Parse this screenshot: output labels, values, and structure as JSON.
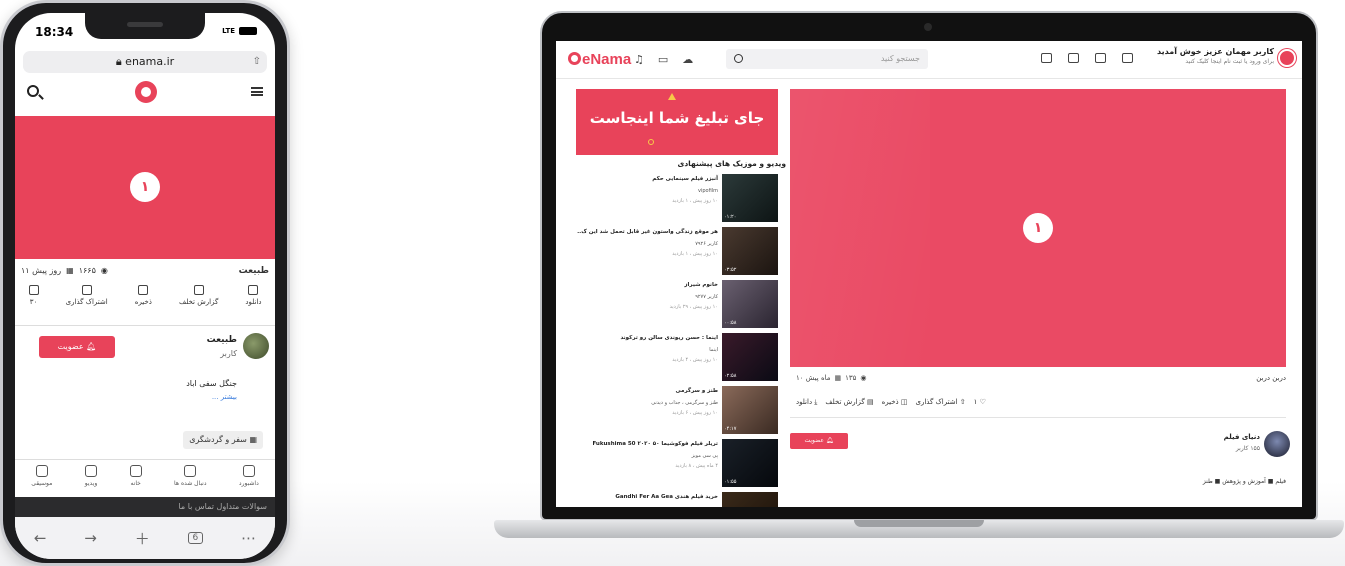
{
  "colors": {
    "brand": "#e8435a",
    "phone_frame": "#1c1c1e",
    "laptop_frame": "#111111"
  },
  "phone": {
    "status": {
      "time": "18:34",
      "network": "LTE"
    },
    "url": "enama.ir",
    "video_number": "۱",
    "meta": {
      "title": "طبیعت",
      "views": "۱۶۶۵",
      "date": "۱۱ روز پیش"
    },
    "actions": [
      {
        "label": "۳۰",
        "icon": "heart-icon"
      },
      {
        "label": "اشتراک گذاری",
        "icon": "share-icon"
      },
      {
        "label": "ذخیره",
        "icon": "bookmark-icon"
      },
      {
        "label": "گزارش تخلف",
        "icon": "report-icon"
      },
      {
        "label": "دانلود",
        "icon": "download-icon"
      }
    ],
    "channel": {
      "name": "طبیعت",
      "subtitle": "کاربر",
      "subscribe_label": "عضویت"
    },
    "description": "جنگل سفی اباد",
    "more_label": "بیشتر ...",
    "tag": "سفر و گردشگری",
    "bottom_nav": [
      {
        "label": "موسیقی",
        "icon": "music-icon"
      },
      {
        "label": "ویدیو",
        "icon": "video-icon"
      },
      {
        "label": "خانه",
        "icon": "home-icon"
      },
      {
        "label": "دنبال شده ها",
        "icon": "bell-icon"
      },
      {
        "label": "داشبورد",
        "icon": "user-icon"
      }
    ],
    "footer": "سوالات متداول   تماس با ما",
    "browser": {
      "tabs_count": "6"
    }
  },
  "laptop": {
    "logo": "eNama",
    "search_placeholder": "جستجو کنید",
    "user": {
      "greeting": "کاربر مهمان عزیز خوش آمدید",
      "hint": "برای ورود یا ثبت نام اینجا کلیک کنید"
    },
    "video_number": "۱",
    "video": {
      "title": "دربن دربن",
      "views": "۱۳۵",
      "date": "۱۰ ماه پیش",
      "actions": [
        "۱",
        "اشتراک گذاری",
        "ذخیره",
        "گزارش تخلف",
        "دانلود"
      ]
    },
    "channel": {
      "name": "دنیای فیلم",
      "subtitle": "۱۵۵ کاربر",
      "subscribe_label": "عضویت"
    },
    "tags": "فیلم ■ آموزش و پژوهش ■ طنز",
    "ad_text": "جای تبلیغ شما اینجاست",
    "suggest_title": "ویدیو و موزیک های پیشنهادی",
    "suggestions": [
      {
        "title": "آنبزر فیلم سینمایی حکم",
        "channel": "vipofilm",
        "meta": "۱۰ روز پیش ، ۱ بازدید",
        "duration": "۰۱:۲۰"
      },
      {
        "title": "هر موقع زندگی واستون غیر قابل تحمل شد این ک..",
        "channel": "کاربر ۷۹۲۶",
        "meta": "۱۰ روز پیش ، ۱ بازدید",
        "duration": "۰۳:۵۲"
      },
      {
        "title": "خانوم شیراز",
        "channel": "کاربر ۹۲۷۷",
        "meta": "۱۰ روز پیش ، ۲۹ بازدید",
        "duration": "۰۰:۵۸"
      },
      {
        "title": "اینما : حسن ریوندی سالن رو ترکوند",
        "channel": "اینما",
        "meta": "۱۰ روز پیش ، ۴ بازدید",
        "duration": "۰۲:۵۸"
      },
      {
        "title": "طنز و سرگرمی",
        "channel": "طنز و سرگرمی ، جذاب و دیدنی",
        "meta": "۱۰ روز پیش ، ۶ بازدید",
        "duration": "۰۴:۱۷"
      },
      {
        "title": "تریلر فیلم فوکوشیما ۵۰ ۲۰۲۰ Fukushima 50",
        "channel": "پی سی موبز",
        "meta": "۴ ماه پیش ، ۸ بازدید",
        "duration": "۰۱:۵۵"
      },
      {
        "title": "خرید فیلم هندی Gandhi Fer Aa Gea",
        "channel": "",
        "meta": "",
        "duration": ""
      }
    ]
  }
}
